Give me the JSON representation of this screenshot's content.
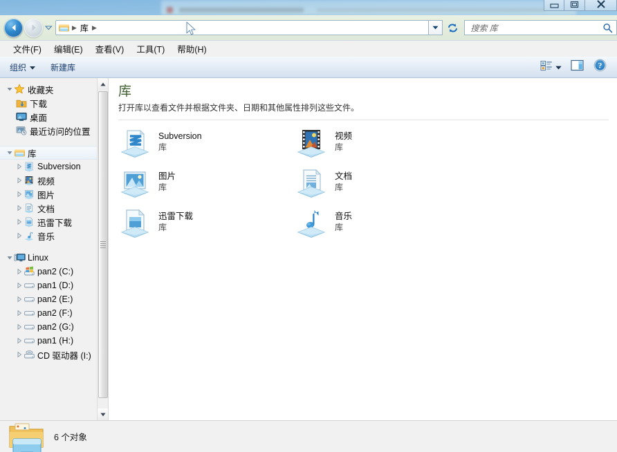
{
  "window": {
    "controls": {
      "minimize": "minimize-button",
      "maximize": "maximize-button",
      "close": "close-button"
    }
  },
  "navigation": {
    "back_tooltip": "后退",
    "forward_tooltip": "前进",
    "history_dropdown": "最近浏览的位置",
    "address": {
      "crumbs": [
        "库"
      ],
      "separator": "▸",
      "dropdown": "▾"
    },
    "refresh": "刷新"
  },
  "search": {
    "placeholder": "搜索 库",
    "value": ""
  },
  "menubar": {
    "items": [
      {
        "label": "文件(F)"
      },
      {
        "label": "编辑(E)"
      },
      {
        "label": "查看(V)"
      },
      {
        "label": "工具(T)"
      },
      {
        "label": "帮助(H)"
      }
    ]
  },
  "toolbar": {
    "organize_label": "组织",
    "organize_caret": "▾",
    "new_library_label": "新建库",
    "view_caret": "▾",
    "preview_pane": "显示预览窗格",
    "help": "帮助"
  },
  "sidebar": {
    "groups": [
      {
        "name": "favorites",
        "root": {
          "label": "收藏夹",
          "icon": "star-icon",
          "expanded": true
        },
        "items": [
          {
            "label": "下载",
            "icon": "downloads-icon"
          },
          {
            "label": "桌面",
            "icon": "desktop-icon"
          },
          {
            "label": "最近访问的位置",
            "icon": "recent-places-icon"
          }
        ]
      },
      {
        "name": "libraries",
        "root": {
          "label": "库",
          "icon": "library-icon",
          "expanded": true,
          "selected": true
        },
        "items": [
          {
            "label": "Subversion",
            "icon": "subversion-library-icon"
          },
          {
            "label": "视频",
            "icon": "video-library-icon"
          },
          {
            "label": "图片",
            "icon": "pictures-library-icon"
          },
          {
            "label": "文档",
            "icon": "documents-library-icon"
          },
          {
            "label": "迅雷下载",
            "icon": "thunder-download-library-icon"
          },
          {
            "label": "音乐",
            "icon": "music-library-icon"
          }
        ]
      },
      {
        "name": "computer",
        "root": {
          "label": "Linux",
          "icon": "computer-icon",
          "expanded": true
        },
        "items": [
          {
            "label": "pan2 (C:)",
            "icon": "system-drive-icon"
          },
          {
            "label": "pan1 (D:)",
            "icon": "drive-icon"
          },
          {
            "label": "pan2 (E:)",
            "icon": "drive-icon"
          },
          {
            "label": "pan2 (F:)",
            "icon": "drive-icon"
          },
          {
            "label": "pan2 (G:)",
            "icon": "drive-icon"
          },
          {
            "label": "pan1 (H:)",
            "icon": "drive-icon"
          },
          {
            "label": "CD 驱动器 (I:)",
            "icon": "cd-drive-icon"
          }
        ]
      }
    ]
  },
  "main": {
    "title": "库",
    "description": "打开库以查看文件并根据文件夹、日期和其他属性排列这些文件。",
    "items": [
      {
        "name": "Subversion",
        "kind": "库",
        "icon": "subversion-library-icon"
      },
      {
        "name": "视频",
        "kind": "库",
        "icon": "video-library-icon"
      },
      {
        "name": "图片",
        "kind": "库",
        "icon": "pictures-library-icon"
      },
      {
        "name": "文档",
        "kind": "库",
        "icon": "documents-library-icon"
      },
      {
        "name": "迅雷下载",
        "kind": "库",
        "icon": "thunder-download-library-icon"
      },
      {
        "name": "音乐",
        "kind": "库",
        "icon": "music-library-icon"
      }
    ]
  },
  "statusbar": {
    "count_text": "6 个对象",
    "icon": "libraries-folder-icon"
  },
  "colors": {
    "title_green": "#3f5f2f",
    "accent_blue": "#2f88cc",
    "nav_strip": "#e4eddd",
    "toolbar_top": "#f4f8fc",
    "pane_bg": "#f1f1f1"
  }
}
